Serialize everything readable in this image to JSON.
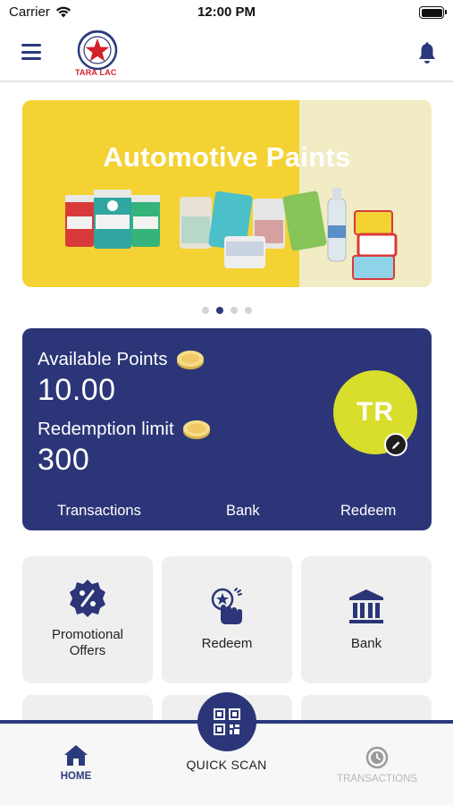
{
  "status_bar": {
    "carrier": "Carrier",
    "time": "12:00 PM"
  },
  "header": {
    "logo_text": "TARA LAC",
    "menu_icon": "hamburger-menu-icon",
    "bell_icon": "bell-icon"
  },
  "banner": {
    "title": "Automotive Paints",
    "slide_count": 4,
    "active_slide": 2
  },
  "points_card": {
    "available_label": "Available Points",
    "available_value": "10.00",
    "limit_label": "Redemption limit",
    "limit_value": "300",
    "avatar_initials": "TR",
    "links": {
      "transactions": "Transactions",
      "bank": "Bank",
      "redeem": "Redeem"
    }
  },
  "tiles": [
    {
      "label": "Promotional Offers",
      "icon": "percent-badge-icon"
    },
    {
      "label": "Redeem",
      "icon": "redeem-hand-icon"
    },
    {
      "label": "Bank",
      "icon": "bank-icon"
    }
  ],
  "bottom_nav": {
    "home": "HOME",
    "quick_scan": "QUICK SCAN",
    "transactions": "TRANSACTIONS"
  },
  "colors": {
    "primary": "#2b3577",
    "banner_yellow": "#f4d234",
    "avatar_yellow": "#d9dd2b",
    "tile_bg": "#efefef",
    "logo_red": "#d42027"
  }
}
